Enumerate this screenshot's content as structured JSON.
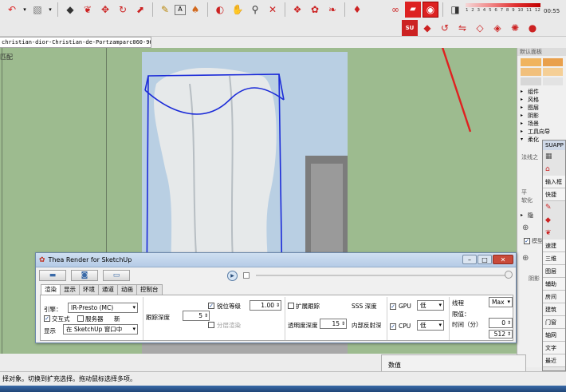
{
  "toolbar": {
    "row1_icons": [
      "arc-tool-icon",
      "dropdown-arrow-icon",
      "material-icon",
      "dropdown-arrow-icon",
      "push-pull-icon",
      "follow-me-icon",
      "move-icon",
      "rotate-icon",
      "scale-icon",
      "tape-measure-icon",
      "text-label-icon",
      "paint-bucket-icon",
      "orbit-icon",
      "pan-icon",
      "zoom-icon",
      "zoom-extents-icon",
      "component-icon",
      "section-icon",
      "warehouse-icon",
      "extension-icon"
    ],
    "render_icons": [
      "thea-link-icon",
      "thea-folder-icon",
      "thea-render-icon"
    ],
    "scale_labels": [
      "1",
      "2",
      "3",
      "4",
      "5",
      "6",
      "7",
      "8",
      "9",
      "10",
      "11",
      "12"
    ],
    "zoom_value": "00:55",
    "row2_icons": [
      "suapp-logo-icon",
      "red-cube-icon",
      "rotate-object-icon",
      "flip-icon",
      "mirror-icon",
      "face-icon",
      "lamp-icon",
      "sphere-icon"
    ]
  },
  "document": {
    "tab_title": "christian-dior-Christian-de-Portzamparc060-960x1438"
  },
  "viewport": {
    "label": "匹配"
  },
  "right_panel": {
    "title": "默认面板",
    "swatches": [
      "#f0b45e",
      "#e9a04c",
      "#f1c07c",
      "#f5cf96",
      "#d7d7d7",
      "#e3e3e3"
    ],
    "items": [
      "组件",
      "风格",
      "图层",
      "阴影",
      "场景",
      "工具向导",
      "柔化"
    ],
    "sub_labels": [
      "法线之",
      "平",
      "软化",
      "阴影"
    ],
    "sub_row": "隐",
    "sub_checkbox": "模型"
  },
  "suapp": {
    "title": "SUAPP",
    "input_label": "输入框",
    "quick_label": "快捷",
    "items": [
      "速建",
      "三维",
      "图层",
      "辅助",
      "房间",
      "建筑",
      "门窗",
      "轴网",
      "文字",
      "最近"
    ]
  },
  "thea": {
    "title": "Thea Render for SketchUp",
    "tabs": [
      "渲染",
      "显示",
      "环境",
      "通道",
      "动画",
      "控制台"
    ],
    "engine_label": "引擎：",
    "engine_value": "IR-Presto (MC)",
    "interactive_label": "交互式",
    "server_label": "服务器",
    "new_label": "新",
    "display_label": "显示",
    "display_value": "在 SketchUp 窗口中",
    "ray_depth_label": "跟踪深度",
    "ray_depth_value": "5",
    "motion_label": "锐位等级",
    "motion_value": "1.00",
    "layer_label": "分层渲染",
    "transparent_label": "透明度深度",
    "transparent_value": "15",
    "caustics_label": "扩展跟踪",
    "sss_label": "SSS 深度",
    "internal_label": "内部反射深",
    "gpu_label": "GPU",
    "gpu_value": "低",
    "cpu_label": "CPU",
    "cpu_value": "低",
    "threads_label": "线程",
    "threads_value": "Max",
    "limit_label": "限值：",
    "time_label": "时间（分）",
    "time_value": "0",
    "samples_value": "512"
  },
  "status": {
    "text": "择对象。切换到扩充选择。拖动鼠标选择多项。",
    "measure_label": "数值"
  }
}
